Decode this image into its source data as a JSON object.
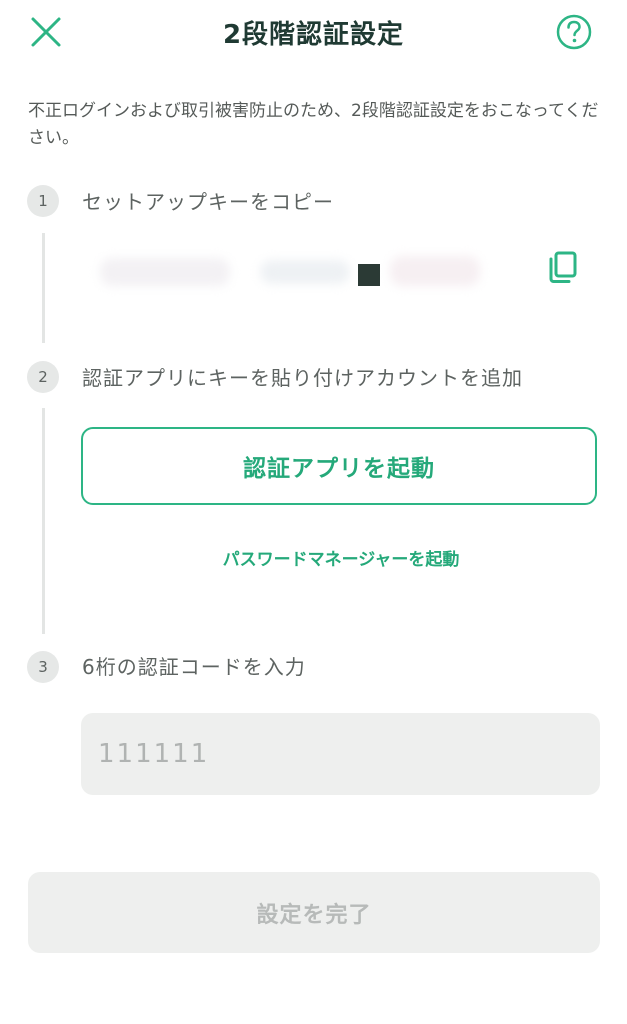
{
  "header": {
    "title": "2段階認証設定",
    "close_icon": "close-icon",
    "help_icon": "help-icon"
  },
  "description": "不正ログインおよび取引被害防止のため、2段階認証設定をおこなってください。",
  "steps": [
    {
      "number": "1",
      "title": "セットアップキーをコピー",
      "copy_icon": "copy-icon"
    },
    {
      "number": "2",
      "title": "認証アプリにキーを貼り付けアカウントを追加",
      "open_app_label": "認証アプリを起動",
      "password_manager_label": "パスワードマネージャーを起動"
    },
    {
      "number": "3",
      "title": "6桁の認証コードを入力",
      "code_input": {
        "value": "",
        "placeholder": "111111"
      }
    }
  ],
  "submit_label": "設定を完了",
  "colors": {
    "accent": "#2db585",
    "accent_text": "#25a97a",
    "title": "#1f3a33",
    "disabled_bg": "#eeefee",
    "disabled_text": "#b7bab9"
  }
}
